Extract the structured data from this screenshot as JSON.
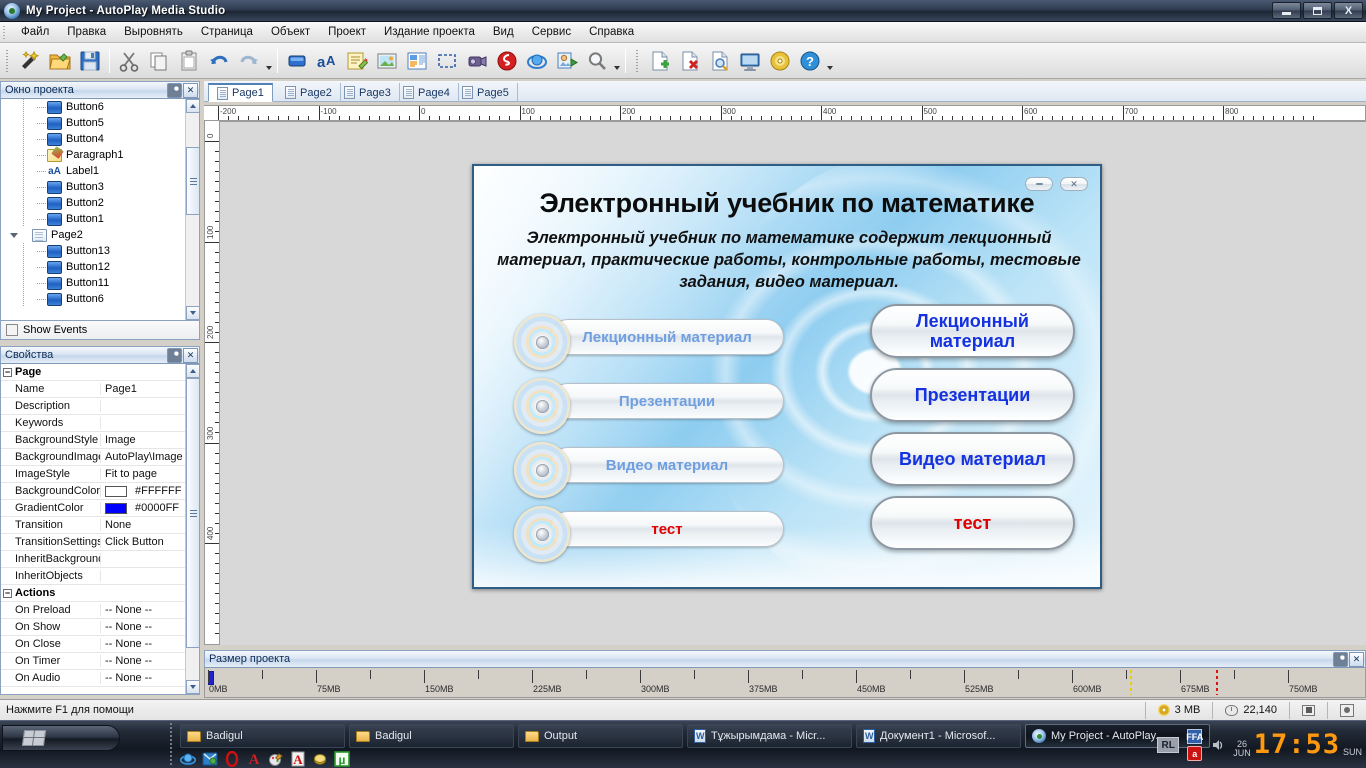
{
  "window": {
    "title": "My Project - AutoPlay Media Studio",
    "icon": "autoplay-disc-icon",
    "buttons": {
      "minimize": "minimize",
      "maximize": "maximize",
      "close": "X"
    }
  },
  "menubar": {
    "items": [
      {
        "label": "Файл"
      },
      {
        "label": "Правка"
      },
      {
        "label": "Выровнять"
      },
      {
        "label": "Страница"
      },
      {
        "label": "Объект"
      },
      {
        "label": "Проект"
      },
      {
        "label": "Издание проекта"
      },
      {
        "label": "Вид"
      },
      {
        "label": "Сервис"
      },
      {
        "label": "Справка"
      }
    ]
  },
  "toolbar": {
    "groups": [
      [
        "new-project-wand-icon",
        "open-folder-icon",
        "save-disk-icon"
      ],
      [
        "cut-scissors-icon",
        "copy-pages-icon",
        "paste-clipboard-icon",
        "undo-arrow-icon",
        "redo-arrow-icon"
      ],
      [
        "button-object-icon",
        "label-object-icon",
        "paragraph-object-icon",
        "image-object-icon",
        "richtext-object-icon",
        "hotspot-object-icon",
        "video-object-icon",
        "flash-object-icon",
        "web-object-icon",
        "slideshow-object-icon",
        "zoom-icon"
      ],
      [
        "add-page-icon",
        "delete-page-icon",
        "preview-page-icon",
        "preview-project-icon",
        "build-cd-icon",
        "help-icon"
      ]
    ]
  },
  "project_window": {
    "title": "Окно проекта",
    "tree": [
      {
        "label": "Button6",
        "icon": "button-icon",
        "level": 2
      },
      {
        "label": "Button5",
        "icon": "button-icon",
        "level": 2
      },
      {
        "label": "Button4",
        "icon": "button-icon",
        "level": 2
      },
      {
        "label": "Paragraph1",
        "icon": "paragraph-icon",
        "level": 2
      },
      {
        "label": "Label1",
        "icon": "label-icon",
        "level": 2
      },
      {
        "label": "Button3",
        "icon": "button-icon",
        "level": 2
      },
      {
        "label": "Button2",
        "icon": "button-icon",
        "level": 2
      },
      {
        "label": "Button1",
        "icon": "button-icon",
        "level": 2
      },
      {
        "label": "Page2",
        "icon": "page-icon",
        "level": 1,
        "expanded": true
      },
      {
        "label": "Button13",
        "icon": "button-icon",
        "level": 2
      },
      {
        "label": "Button12",
        "icon": "button-icon",
        "level": 2
      },
      {
        "label": "Button11",
        "icon": "button-icon",
        "level": 2
      },
      {
        "label": "Button6",
        "icon": "button-icon",
        "level": 2
      }
    ],
    "show_events_label": "Show Events",
    "show_events_checked": false
  },
  "properties": {
    "title": "Свойства",
    "groups": [
      {
        "name": "Page",
        "rows": [
          {
            "key": "Name",
            "value": "Page1"
          },
          {
            "key": "Description",
            "value": ""
          },
          {
            "key": "Keywords",
            "value": ""
          },
          {
            "key": "BackgroundStyle",
            "value": "Image"
          },
          {
            "key": "BackgroundImage",
            "value": "AutoPlay\\Image"
          },
          {
            "key": "ImageStyle",
            "value": "Fit to page"
          },
          {
            "key": "BackgroundColor",
            "value": "#FFFFFF",
            "swatch": "#FFFFFF"
          },
          {
            "key": "GradientColor",
            "value": "#0000FF",
            "swatch": "#0000FF"
          },
          {
            "key": "Transition",
            "value": "None"
          },
          {
            "key": "TransitionSettings",
            "value": "Click Button"
          },
          {
            "key": "InheritBackground",
            "value": ""
          },
          {
            "key": "InheritObjects",
            "value": ""
          }
        ]
      },
      {
        "name": "Actions",
        "rows": [
          {
            "key": "On Preload",
            "value": "-- None --"
          },
          {
            "key": "On Show",
            "value": "-- None --"
          },
          {
            "key": "On Close",
            "value": "-- None --"
          },
          {
            "key": "On Timer",
            "value": "-- None --"
          },
          {
            "key": "On Audio",
            "value": "-- None --"
          }
        ]
      }
    ]
  },
  "tabs": {
    "items": [
      {
        "label": "Page1",
        "active": true
      },
      {
        "label": "Page2",
        "active": false
      },
      {
        "label": "Page3",
        "active": false
      },
      {
        "label": "Page4",
        "active": false
      },
      {
        "label": "Page5",
        "active": false
      }
    ]
  },
  "rulers": {
    "horizontal_labels": [
      "-200",
      "-100",
      "0",
      "100",
      "200",
      "300",
      "400",
      "500",
      "600",
      "700",
      "800"
    ],
    "vertical_labels": [
      "0",
      "100",
      "200",
      "300",
      "400"
    ]
  },
  "design_page": {
    "title": "Электронный учебник по математике",
    "description": "Электронный учебник по математике содержит лекционный материал, практические работы, контрольные работы, тестовые задания, видео материал.",
    "window_controls": {
      "minimize": "minimize-pill",
      "close": "close-pill"
    },
    "left_buttons": [
      {
        "label": "Лекционный материал",
        "color": "#6f9fe0",
        "icon": "cd-disc-icon"
      },
      {
        "label": "Презентации",
        "color": "#6f9fe0",
        "icon": "cd-disc-icon"
      },
      {
        "label": "Видео материал",
        "color": "#6f9fe0",
        "icon": "cd-disc-icon"
      },
      {
        "label": "тест",
        "color": "#e00000",
        "icon": "cd-disc-icon"
      }
    ],
    "right_buttons": [
      {
        "label": "Лекционный материал",
        "color": "#1432e0"
      },
      {
        "label": "Презентации",
        "color": "#1432e0"
      },
      {
        "label": "Видео материал",
        "color": "#1432e0"
      },
      {
        "label": "тест",
        "color": "#e00000"
      }
    ]
  },
  "project_size": {
    "title": "Размер проекта",
    "labels": [
      "0MB",
      "75MB",
      "150MB",
      "225MB",
      "300MB",
      "375MB",
      "450MB",
      "525MB",
      "600MB",
      "675MB",
      "750MB"
    ],
    "used_mb": 3,
    "markers": [
      {
        "position_mb": 640,
        "color": "#e8d000"
      },
      {
        "position_mb": 700,
        "color": "#dd1111"
      }
    ]
  },
  "statusbar": {
    "hint": "Нажмите F1 для помощи",
    "project_size": "3 MB",
    "object_count": "22,140",
    "icons": [
      "cd-size-icon",
      "mouse-icon",
      "fullscreen-icon",
      "target-icon"
    ]
  },
  "taskbar": {
    "start_label": "",
    "tasks": [
      {
        "label": "Badigul",
        "icon": "folder-icon",
        "active": false
      },
      {
        "label": "Badigul",
        "icon": "folder-icon",
        "active": false
      },
      {
        "label": "Output",
        "icon": "folder-icon",
        "active": false
      },
      {
        "label": "Тұжырымдама - Micr...",
        "icon": "word-icon",
        "active": false
      },
      {
        "label": "Документ1 - Microsof...",
        "icon": "word-icon",
        "active": false
      },
      {
        "label": "My Project - AutoPlay...",
        "icon": "autoplay-icon",
        "active": true
      }
    ],
    "quicklaunch": [
      "ie-icon",
      "outlook-icon",
      "opera-icon",
      "abbyy-icon",
      "paint-icon",
      "acrobat-icon",
      "coin-icon",
      "mu-icon"
    ],
    "tray": {
      "language": "RL",
      "icons": [
        "ffa-icon",
        "volume-icon",
        "avira-icon"
      ],
      "date_day": "26",
      "date_month": "JUN",
      "time": "17:53",
      "weekday": "SUN"
    }
  }
}
